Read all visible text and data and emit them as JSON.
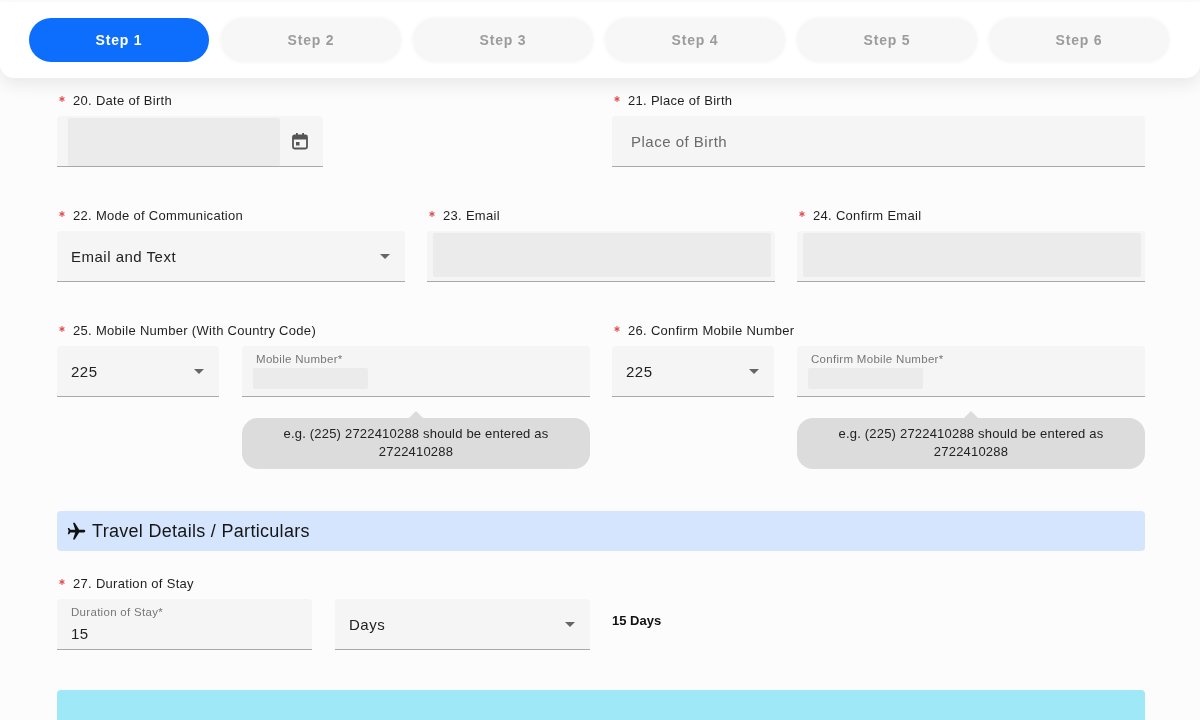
{
  "stepper": {
    "steps": [
      {
        "label": "Step 1",
        "selected": true
      },
      {
        "label": "Step 2",
        "selected": false
      },
      {
        "label": "Step 3",
        "selected": false
      },
      {
        "label": "Step 4",
        "selected": false
      },
      {
        "label": "Step 5",
        "selected": false
      },
      {
        "label": "Step 6",
        "selected": false
      }
    ]
  },
  "form": {
    "rows": [
      {
        "groups": [
          {
            "label": "20. Date of Birth",
            "required": true,
            "controls": [
              {
                "kind": "date",
                "value_hidden": true
              }
            ]
          },
          {
            "label": "21. Place of Birth",
            "required": true,
            "controls": [
              {
                "kind": "text",
                "placeholder": "Place of Birth"
              }
            ]
          }
        ]
      },
      {
        "groups": [
          {
            "label": "22. Mode of Communication",
            "required": true,
            "controls": [
              {
                "kind": "select",
                "value": "Email and Text"
              }
            ]
          },
          {
            "label": "23. Email",
            "required": true,
            "controls": [
              {
                "kind": "text",
                "value_hidden": true
              }
            ]
          },
          {
            "label": "24. Confirm Email",
            "required": true,
            "controls": [
              {
                "kind": "text",
                "value_hidden": true
              }
            ]
          }
        ]
      },
      {
        "groups": [
          {
            "label": "25. Mobile Number (With Country Code)",
            "required": true,
            "controls": [
              {
                "kind": "code-select",
                "value": "225"
              },
              {
                "kind": "text",
                "floating_label": "Mobile Number*",
                "value_hidden": true,
                "hint": "e.g. (225) 2722410288 should be entered as 2722410288"
              }
            ]
          },
          {
            "label": "26. Confirm Mobile Number",
            "required": true,
            "controls": [
              {
                "kind": "code-select",
                "value": "225"
              },
              {
                "kind": "text",
                "floating_label": "Confirm Mobile Number*",
                "value_hidden": true,
                "hint": "e.g. (225) 2722410288 should be entered as 2722410288"
              }
            ]
          }
        ]
      }
    ]
  },
  "travel_section": {
    "title": "Travel Details / Particulars",
    "rows": [
      {
        "groups": [
          {
            "label": "27. Duration of Stay",
            "required": true,
            "controls": [
              {
                "kind": "text",
                "floating_label": "Duration of Stay*",
                "value": "15"
              },
              {
                "kind": "select",
                "value": "Days"
              }
            ],
            "summary": "15 Days"
          }
        ]
      }
    ]
  }
}
